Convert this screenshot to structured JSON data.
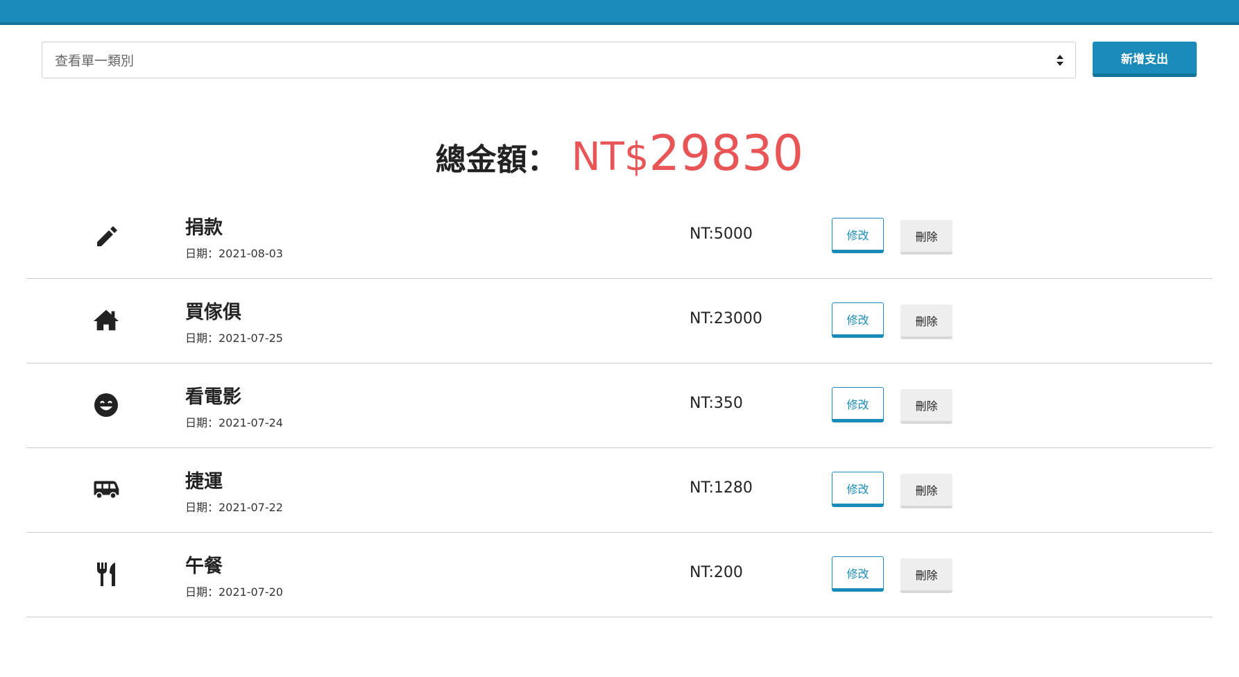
{
  "header": {
    "bar_color": "#1a8ab9"
  },
  "filter": {
    "placeholder": "查看單一類別"
  },
  "toolbar": {
    "add_label": "新增支出"
  },
  "total": {
    "label": "總金額：",
    "currency": "NT$",
    "amount": "29830",
    "color": "#e85557"
  },
  "expenses": [
    {
      "icon": "pencil-icon",
      "title": "捐款",
      "date": "日期：2021-08-03",
      "amount": "NT:5000",
      "edit_label": "修改",
      "delete_label": "刪除"
    },
    {
      "icon": "home-icon",
      "title": "買傢俱",
      "date": "日期：2021-07-25",
      "amount": "NT:23000",
      "edit_label": "修改",
      "delete_label": "刪除"
    },
    {
      "icon": "smile-icon",
      "title": "看電影",
      "date": "日期：2021-07-24",
      "amount": "NT:350",
      "edit_label": "修改",
      "delete_label": "刪除"
    },
    {
      "icon": "bus-icon",
      "title": "捷運",
      "date": "日期：2021-07-22",
      "amount": "NT:1280",
      "edit_label": "修改",
      "delete_label": "刪除"
    },
    {
      "icon": "utensils-icon",
      "title": "午餐",
      "date": "日期：2021-07-20",
      "amount": "NT:200",
      "edit_label": "修改",
      "delete_label": "刪除"
    }
  ]
}
